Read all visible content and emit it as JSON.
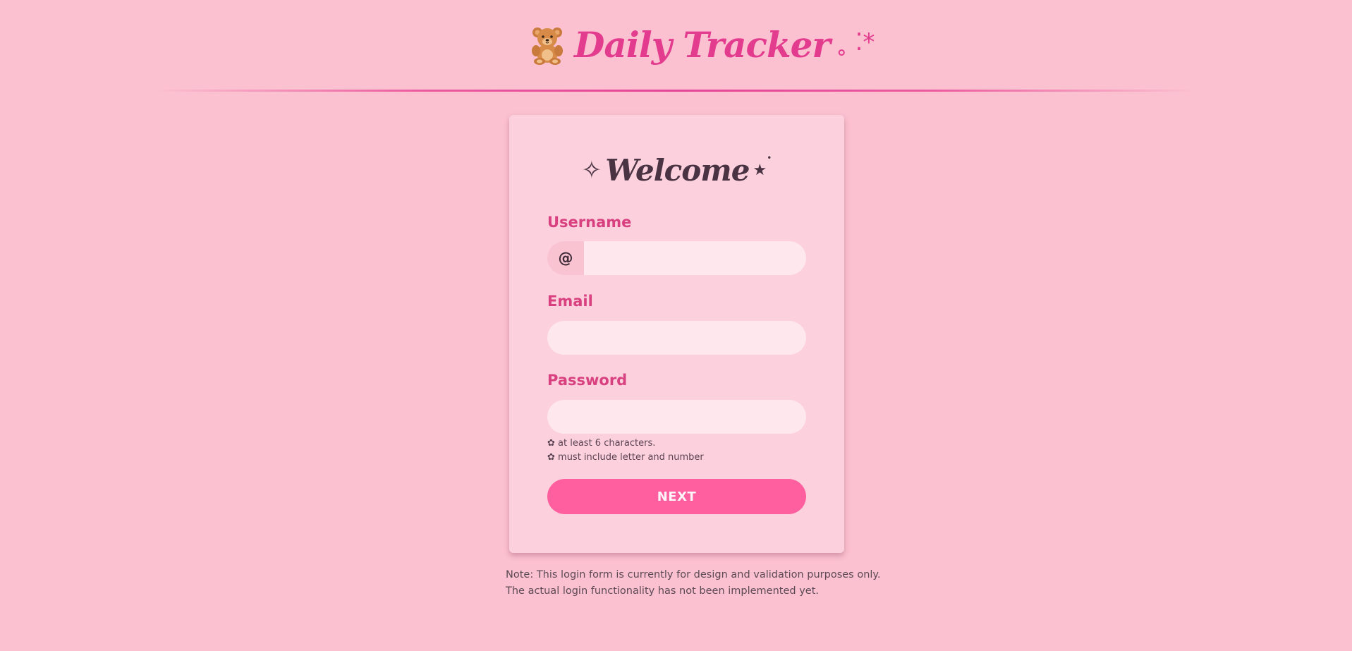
{
  "header": {
    "title": "Daily Tracker",
    "title_deco": "˳ ⁚*",
    "logo_icon": "teddy-bear-icon"
  },
  "form": {
    "heading": "Welcome",
    "heading_sparkle_left": "✧",
    "heading_star_right": "★",
    "heading_dot_right": "•",
    "username": {
      "label": "Username",
      "prefix": "@",
      "value": "",
      "placeholder": ""
    },
    "email": {
      "label": "Email",
      "value": "",
      "placeholder": ""
    },
    "password": {
      "label": "Password",
      "value": "",
      "placeholder": ""
    },
    "password_hints": [
      "✿ at least 6 characters.",
      "✿ must include letter and number"
    ],
    "submit_label": "NEXT"
  },
  "note": {
    "line1": "Note: This login form is currently for design and validation purposes only.",
    "line2": "The actual login functionality has not been implemented yet."
  },
  "colors": {
    "background": "#fbc1d0",
    "card": "#fcd1dd",
    "accent": "#e33b8e",
    "label": "#d9407f",
    "input": "#ffe7ee",
    "button": "#ff5f9e",
    "text_dark": "#4a3343"
  }
}
